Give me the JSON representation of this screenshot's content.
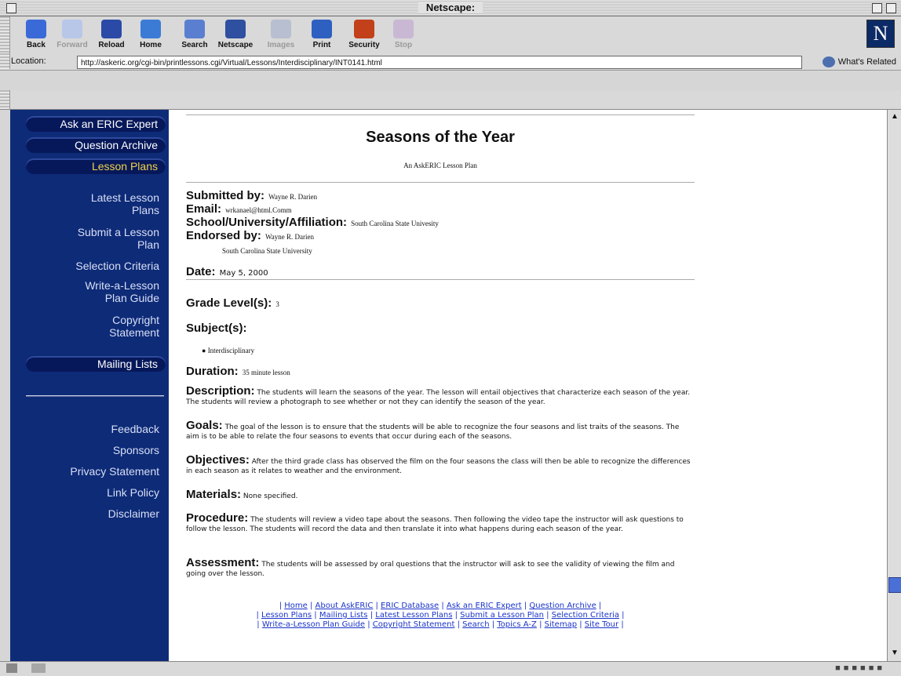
{
  "window": {
    "title": "Netscape:"
  },
  "toolbar": {
    "buttons": [
      {
        "label": "Back",
        "icon": "back-arrow-icon",
        "enabled": true,
        "color": "#3a6ad8"
      },
      {
        "label": "Forward",
        "icon": "forward-arrow-icon",
        "enabled": false,
        "color": "#b8c7e8"
      },
      {
        "label": "Reload",
        "icon": "reload-icon",
        "enabled": true,
        "color": "#2b4aa8"
      },
      {
        "label": "Home",
        "icon": "home-icon",
        "enabled": true,
        "color": "#3b7bd6"
      },
      {
        "label": "Search",
        "icon": "search-icon",
        "enabled": true,
        "color": "#5a7fd0"
      },
      {
        "label": "Netscape",
        "icon": "netscape-icon",
        "enabled": true,
        "color": "#2f4fa0"
      },
      {
        "label": "Images",
        "icon": "images-icon",
        "enabled": false,
        "color": "#b7bfd0"
      },
      {
        "label": "Print",
        "icon": "print-icon",
        "enabled": true,
        "color": "#2e60c2"
      },
      {
        "label": "Security",
        "icon": "security-lock-icon",
        "enabled": true,
        "color": "#c2401a"
      },
      {
        "label": "Stop",
        "icon": "stop-icon",
        "enabled": false,
        "color": "#c9b8d4"
      }
    ]
  },
  "location": {
    "label": "Location:",
    "url": "http://askeric.org/cgi-bin/printlessons.cgi/Virtual/Lessons/Interdisciplinary/INT0141.html",
    "related_label": "What's Related"
  },
  "sidebar": {
    "pills": [
      {
        "label": "Ask an ERIC Expert",
        "selected": false
      },
      {
        "label": "Question Archive",
        "selected": false
      },
      {
        "label": "Lesson Plans",
        "selected": true
      }
    ],
    "lesson_links": [
      {
        "line1": "Latest Lesson",
        "line2": "Plans"
      },
      {
        "line1": "Submit a Lesson",
        "line2": "Plan"
      },
      {
        "line1": "Selection Criteria",
        "line2": ""
      },
      {
        "line1": "Write-a-Lesson",
        "line2": "Plan Guide"
      },
      {
        "line1": "Copyright",
        "line2": "Statement"
      }
    ],
    "mailing_pill": "Mailing Lists",
    "bottom_links": [
      "Feedback",
      "Sponsors",
      "Privacy Statement",
      "Link Policy",
      "Disclaimer"
    ]
  },
  "lesson": {
    "title": "Seasons of the Year",
    "subtitle": "An AskERIC Lesson Plan",
    "submitted_label": "Submitted by:",
    "submitted_value": "Wayne R. Darien",
    "email_label": "Email:",
    "email_value": "wrkanael@html.Comm",
    "school_label": "School/University/Affiliation:",
    "school_value": "South Carolina State Univesity",
    "endorsed_label": "Endorsed by:",
    "endorsed_value": "Wayne R. Darien",
    "endorsed_value2": "South Carolina State University",
    "date_label": "Date:",
    "date_value": "May 5, 2000",
    "grade_label": "Grade Level(s):",
    "grade_value": "3",
    "subject_label": "Subject(s):",
    "subject_items": [
      "Interdisciplinary"
    ],
    "duration_label": "Duration:",
    "duration_value": "35 minute lesson",
    "description_label": "Description:",
    "description_text": "The students will learn the seasons of the year. The lesson will entail objectives that characterize each season of the year. The students will review a photograph to see whether or not they can identify the season of the year.",
    "goals_label": "Goals:",
    "goals_text": "The goal of the lesson is to ensure that the students will be able to recognize the four seasons and list traits of the seasons. The aim is to be able to relate the four seasons to events that occur during each of the seasons.",
    "objectives_label": "Objectives:",
    "objectives_text": "After the third grade class has observed the film on the four seasons the class will then be able to recognize the differences in each season as it relates to weather and the environment.",
    "materials_label": "Materials:",
    "materials_text": "None specified.",
    "procedure_label": "Procedure:",
    "procedure_text": "The students will review a video tape about the seasons. Then following the video tape the instructor will ask questions to follow the lesson. The students will record the data and then translate it into what happens during each season of the year.",
    "assessment_label": "Assessment:",
    "assessment_text": "The students will be assessed by oral questions that the instructor will ask to see the validity of viewing the film and going over the lesson."
  },
  "footer": {
    "line1": [
      "Home",
      "About AskERIC",
      "ERIC Database",
      "Ask an ERIC Expert",
      "Question Archive"
    ],
    "line2": [
      "Lesson Plans",
      "Mailing Lists",
      "Latest Lesson Plans",
      "Submit a Lesson Plan",
      "Selection Criteria"
    ],
    "line3": [
      "Write-a-Lesson Plan Guide",
      "Copyright Statement",
      "Search",
      "Topics A-Z",
      "Sitemap",
      "Site Tour"
    ]
  },
  "colors": {
    "sidebar_bg": "#0e2b78",
    "pill_bg": "#06185a",
    "selected_pill_text": "#f2d24a",
    "link": "#1a33c8"
  }
}
